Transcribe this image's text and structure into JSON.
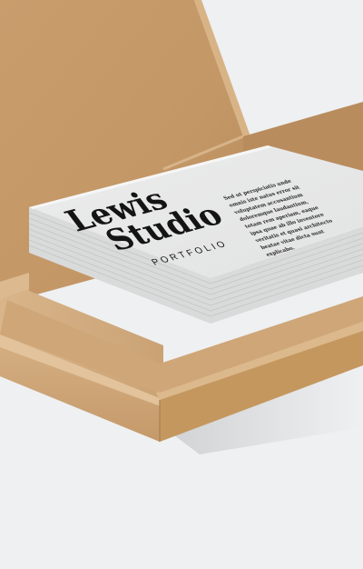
{
  "card": {
    "title_line1": "Lewis",
    "title_line2": "Studio",
    "subtitle": "PORTFOLIO",
    "paragraph_lines": [
      "Sed ut perspiciatis unde",
      "omnis iste natus error sit",
      "voluptatem accusantium",
      "doloremque laudantium,",
      "totam rem aperiam, eaque",
      "ipsa quae ab illo inventore",
      "veritatis et quasi architecto",
      "beatae vitae dicta sunt",
      "explicabo."
    ]
  },
  "colors": {
    "background": "#eef0f2",
    "kraft": "#c89f72",
    "kraft_dark": "#b08458",
    "card": "#e9eaea",
    "ink": "#141414"
  }
}
